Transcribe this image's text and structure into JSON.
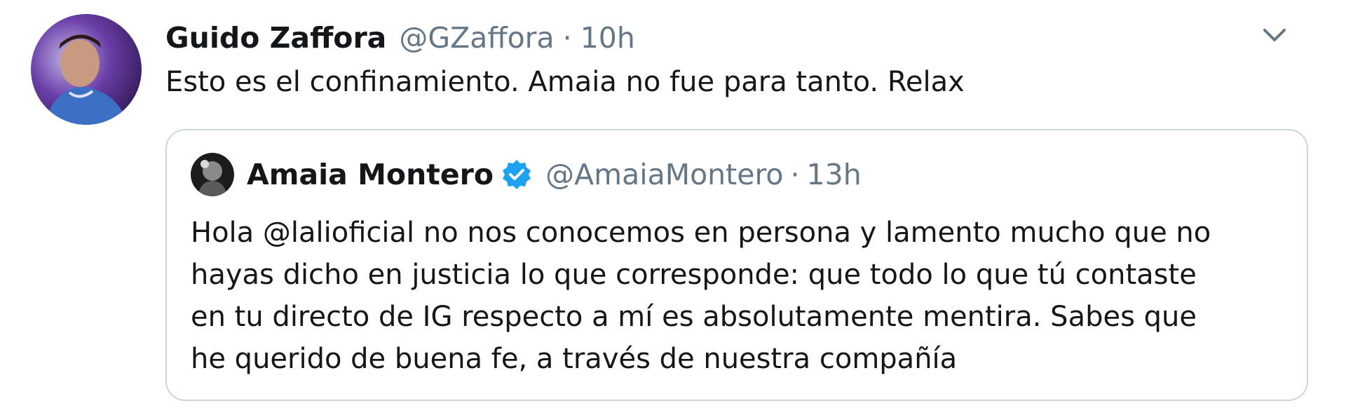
{
  "tweet": {
    "author_name": "Guido Zaffora",
    "author_handle": "@GZaffora",
    "separator": "·",
    "time": "10h",
    "text": "Esto es el confinamiento. Amaia no fue para tanto. Relax",
    "menu_icon": "chevron-down-icon"
  },
  "quoted_tweet": {
    "author_name": "Amaia Montero",
    "verified_icon": "verified-badge-icon",
    "author_handle": "@AmaiaMontero",
    "separator": "·",
    "time": "13h",
    "lines": [
      "Hola @lalioficial no nos conocemos en persona y lamento mucho que no",
      "hayas dicho en justicia lo que corresponde: que todo lo que tú contaste",
      "en tu directo de IG respecto a mí es absolutamente mentira. Sabes que",
      "he querido de buena fe, a través de nuestra compañía"
    ]
  },
  "colors": {
    "text_primary": "#14171a",
    "text_secondary": "#657786",
    "border": "#ccd6dd",
    "verified_blue": "#1da1f2"
  }
}
